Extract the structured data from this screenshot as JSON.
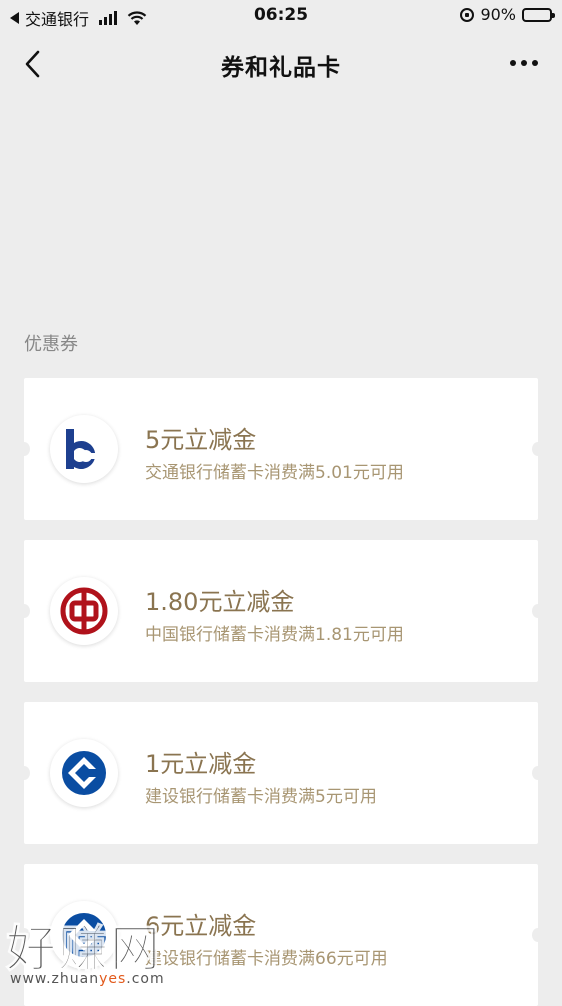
{
  "status_bar": {
    "carrier": "交通银行",
    "time": "06:25",
    "battery_text": "90%",
    "battery_level": 0.9
  },
  "nav": {
    "title": "券和礼品卡",
    "back_icon": "chevron-left-icon",
    "more_icon": "more-horizontal-icon"
  },
  "section": {
    "label": "优惠券"
  },
  "coupons": [
    {
      "bank": "bocom",
      "title": "5元立减金",
      "desc": "交通银行储蓄卡消费满5.01元可用"
    },
    {
      "bank": "boc",
      "title": "1.80元立减金",
      "desc": "中国银行储蓄卡消费满1.81元可用"
    },
    {
      "bank": "ccb",
      "title": "1元立减金",
      "desc": "建设银行储蓄卡消费满5元可用"
    },
    {
      "bank": "ccb",
      "title": "6元立减金",
      "desc": "建设银行储蓄卡消费满66元可用"
    }
  ],
  "colors": {
    "background": "#ededed",
    "coupon_title": "#8a7450",
    "coupon_desc": "#a89673",
    "bocom_blue": "#1d3f8f",
    "boc_red": "#b0121b",
    "ccb_blue": "#0a4da2"
  },
  "watermark": {
    "text": "好赚网",
    "url_prefix": "www.zhuan",
    "url_highlight": "yes",
    "url_suffix": ".com"
  }
}
